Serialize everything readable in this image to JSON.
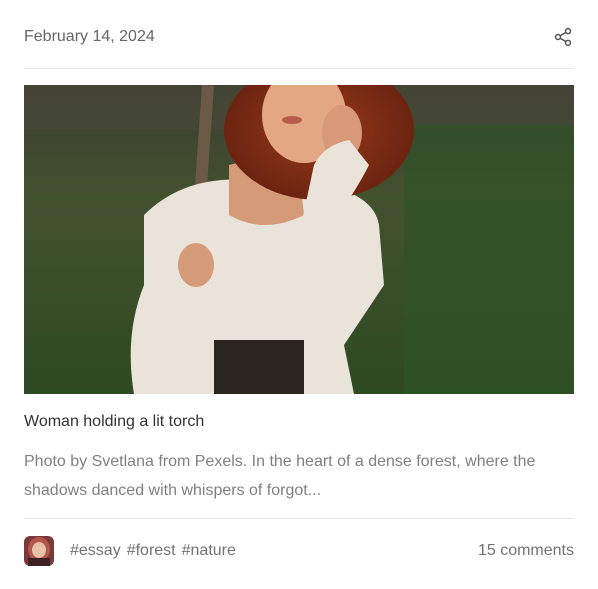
{
  "post": {
    "date": "February 14, 2024",
    "share_icon": "share-icon",
    "image_alt": "Woman holding a lit torch",
    "title": "Woman holding a lit torch",
    "excerpt": "Photo by Svetlana from Pexels. In the heart of a dense forest, where the shadows danced with whispers of forgot...",
    "tags": [
      "#essay",
      "#forest",
      "#nature"
    ],
    "comments": "15 comments",
    "avatar_icon": "author-avatar"
  },
  "colors": {
    "date_text": "#666666",
    "title_text": "#333333",
    "body_text": "#808080",
    "divider": "#e6e6e6"
  }
}
